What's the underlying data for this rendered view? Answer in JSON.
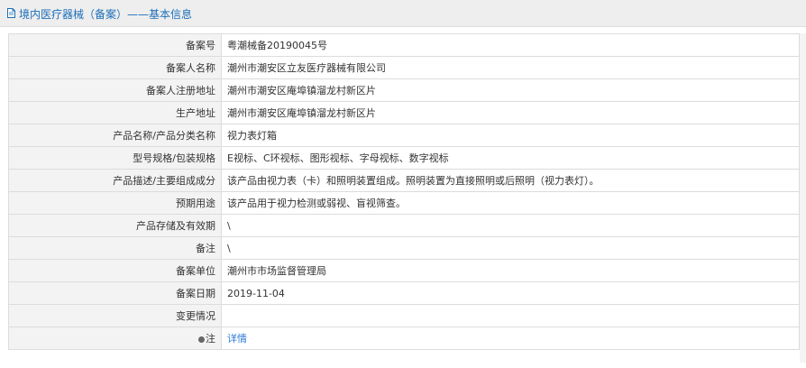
{
  "header": {
    "title": "境内医疗器械（备案）——基本信息"
  },
  "rows": [
    {
      "label": "备案号",
      "value": "粤潮械备20190045号"
    },
    {
      "label": "备案人名称",
      "value": "潮州市潮安区立友医疗器械有限公司"
    },
    {
      "label": "备案人注册地址",
      "value": "潮州市潮安区庵埠镇溜龙村新区片"
    },
    {
      "label": "生产地址",
      "value": "潮州市潮安区庵埠镇溜龙村新区片"
    },
    {
      "label": "产品名称/产品分类名称",
      "value": "视力表灯箱"
    },
    {
      "label": "型号规格/包装规格",
      "value": "E视标、C环视标、图形视标、字母视标、数字视标"
    },
    {
      "label": "产品描述/主要组成成分",
      "value": "该产品由视力表（卡）和照明装置组成。照明装置为直接照明或后照明（视力表灯）。"
    },
    {
      "label": "预期用途",
      "value": "该产品用于视力检测或弱视、盲视筛查。"
    },
    {
      "label": "产品存储及有效期",
      "value": "\\"
    },
    {
      "label": "备注",
      "value": "\\"
    },
    {
      "label": "备案单位",
      "value": "潮州市市场监督管理局"
    },
    {
      "label": "备案日期",
      "value": "2019-11-04"
    },
    {
      "label": "变更情况",
      "value": ""
    }
  ],
  "note_row": {
    "label": "注",
    "link": "详情",
    "icon": "bullet-icon"
  },
  "colors": {
    "title": "#1c6fb9",
    "link": "#2b7ad6",
    "label_bg": "#f3f3f3",
    "border": "#dcdcdc"
  }
}
